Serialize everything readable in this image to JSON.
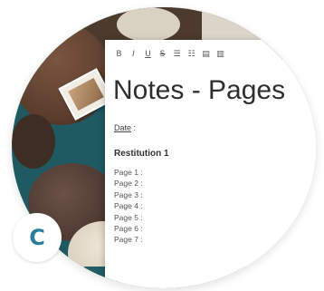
{
  "toolbar": {
    "items": [
      {
        "glyph": "B",
        "icon": "bold-icon"
      },
      {
        "glyph": "I",
        "icon": "italic-icon"
      },
      {
        "glyph": "U",
        "icon": "underline-icon"
      },
      {
        "glyph": "S",
        "icon": "strikethrough-icon"
      },
      {
        "glyph": "☰",
        "icon": "bullet-list-icon"
      },
      {
        "glyph": "☷",
        "icon": "numbered-list-icon"
      },
      {
        "glyph": "▤",
        "icon": "indent-icon"
      },
      {
        "glyph": "▥",
        "icon": "outdent-icon"
      }
    ]
  },
  "document": {
    "title": "Notes - Pages",
    "date_label": "Date",
    "date_suffix": ":",
    "section_heading": "Restitution 1",
    "pages": [
      "Page 1 :",
      "Page 2 :",
      "Page 3 :",
      "Page 4 :",
      "Page 5 :",
      "Page 6 :",
      "Page 7 :"
    ]
  },
  "badge": {
    "letter": "C"
  },
  "colors": {
    "badge_text": "#2a7d9a",
    "teal_background": "#1f5a63",
    "paper": "#ffffff"
  }
}
